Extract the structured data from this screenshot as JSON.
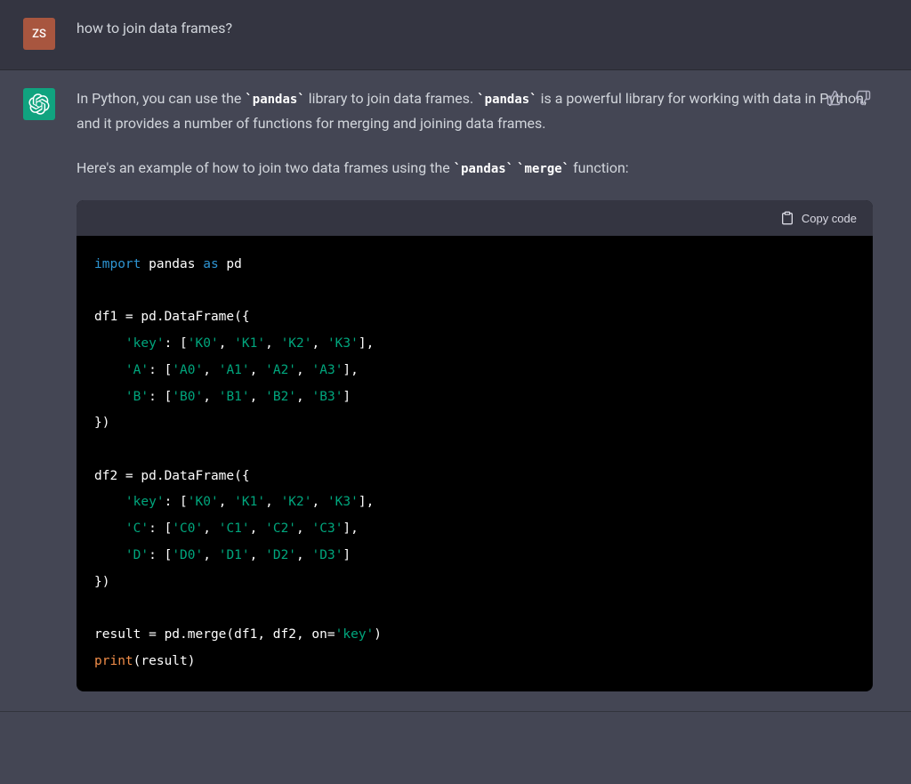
{
  "user": {
    "initials": "ZS",
    "message": "how to join data frames?"
  },
  "assistant": {
    "paragraph1_parts": {
      "p1": "In Python, you can use the ",
      "c1": "`pandas`",
      "p2": " library to join data frames. ",
      "c2": "`pandas`",
      "p3": " is a powerful library for working with data in Python, and it provides a number of functions for merging and joining data frames."
    },
    "paragraph2_parts": {
      "p1": "Here's an example of how to join two data frames using the ",
      "c1": "`pandas`",
      "p2": " ",
      "c2": "`merge`",
      "p3": " function:"
    },
    "copy_label": "Copy code",
    "code": {
      "l1_kw_import": "import",
      "l1_id_pandas": " pandas ",
      "l1_kw_as": "as",
      "l1_id_pd": " pd",
      "l3": "df1 = pd.DataFrame({",
      "l4_pre": "    ",
      "l4_s1": "'key'",
      "l4_mid1": ": [",
      "l4_s2": "'K0'",
      "l4_c": ", ",
      "l4_s3": "'K1'",
      "l4_s4": "'K2'",
      "l4_s5": "'K3'",
      "l4_end": "],",
      "l5_s1": "'A'",
      "l5_s2": "'A0'",
      "l5_s3": "'A1'",
      "l5_s4": "'A2'",
      "l5_s5": "'A3'",
      "l6_s1": "'B'",
      "l6_s2": "'B0'",
      "l6_s3": "'B1'",
      "l6_s4": "'B2'",
      "l6_s5": "'B3'",
      "l6_end": "]",
      "l7": "})",
      "l9": "df2 = pd.DataFrame({",
      "l11_s1": "'C'",
      "l11_s2": "'C0'",
      "l11_s3": "'C1'",
      "l11_s4": "'C2'",
      "l11_s5": "'C3'",
      "l12_s1": "'D'",
      "l12_s2": "'D0'",
      "l12_s3": "'D1'",
      "l12_s4": "'D2'",
      "l12_s5": "'D3'",
      "l15_pre": "result = pd.merge(df1, df2, on=",
      "l15_s": "'key'",
      "l15_post": ")",
      "l16_fn": "print",
      "l16_post": "(result)"
    }
  }
}
